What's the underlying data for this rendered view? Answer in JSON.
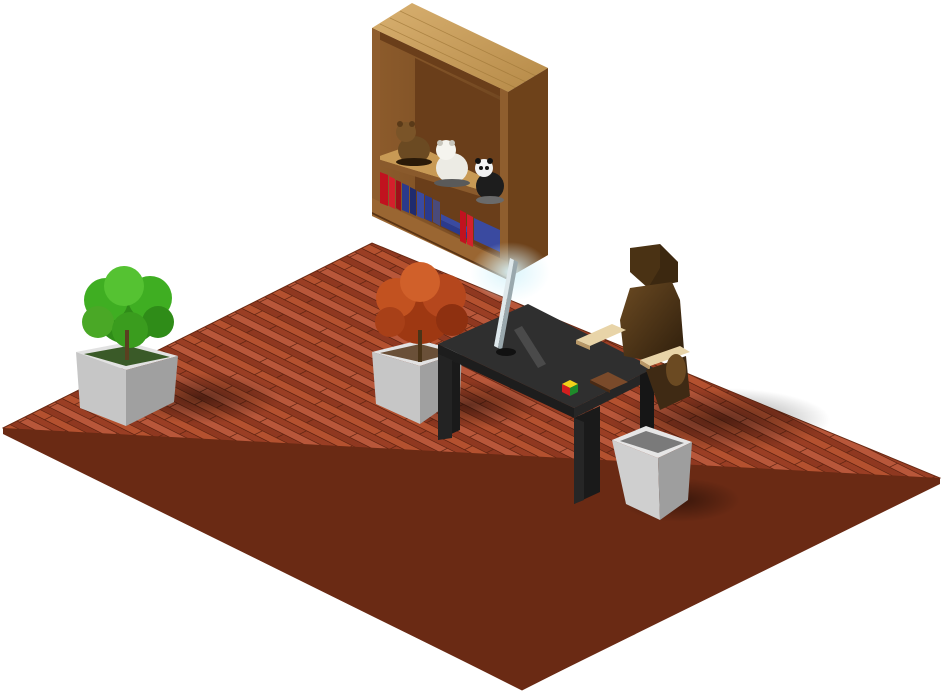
{
  "scene": {
    "objects": [
      "wooden-floor",
      "bookshelf",
      "books",
      "figurines",
      "green-plant",
      "red-plant",
      "desk",
      "monitor",
      "keyboard",
      "rubiks-cube",
      "notebook",
      "office-chair",
      "wastebasket"
    ]
  },
  "colors": {
    "background": "#ffffff",
    "floor": "#a8462a",
    "floor_dark": "#7a2e18",
    "floor_light": "#c2603c",
    "wood_shelf": "#8a5a2c",
    "wood_shelf_light": "#c89a55",
    "wood_shelf_dark": "#5c3818",
    "desk_top": "#2f2f2f",
    "desk_side": "#1d1d1d",
    "chair_leather": "#3f2a14",
    "chair_light": "#6b4a22",
    "pot_light": "#d2d2d2",
    "pot_dark": "#9a9a9a",
    "foliage_green": "#3fae22",
    "foliage_red": "#b5471d",
    "book_red": "#c1121f",
    "book_blue": "#2b3a8c",
    "monitor_glow": "#c8ecf5"
  }
}
